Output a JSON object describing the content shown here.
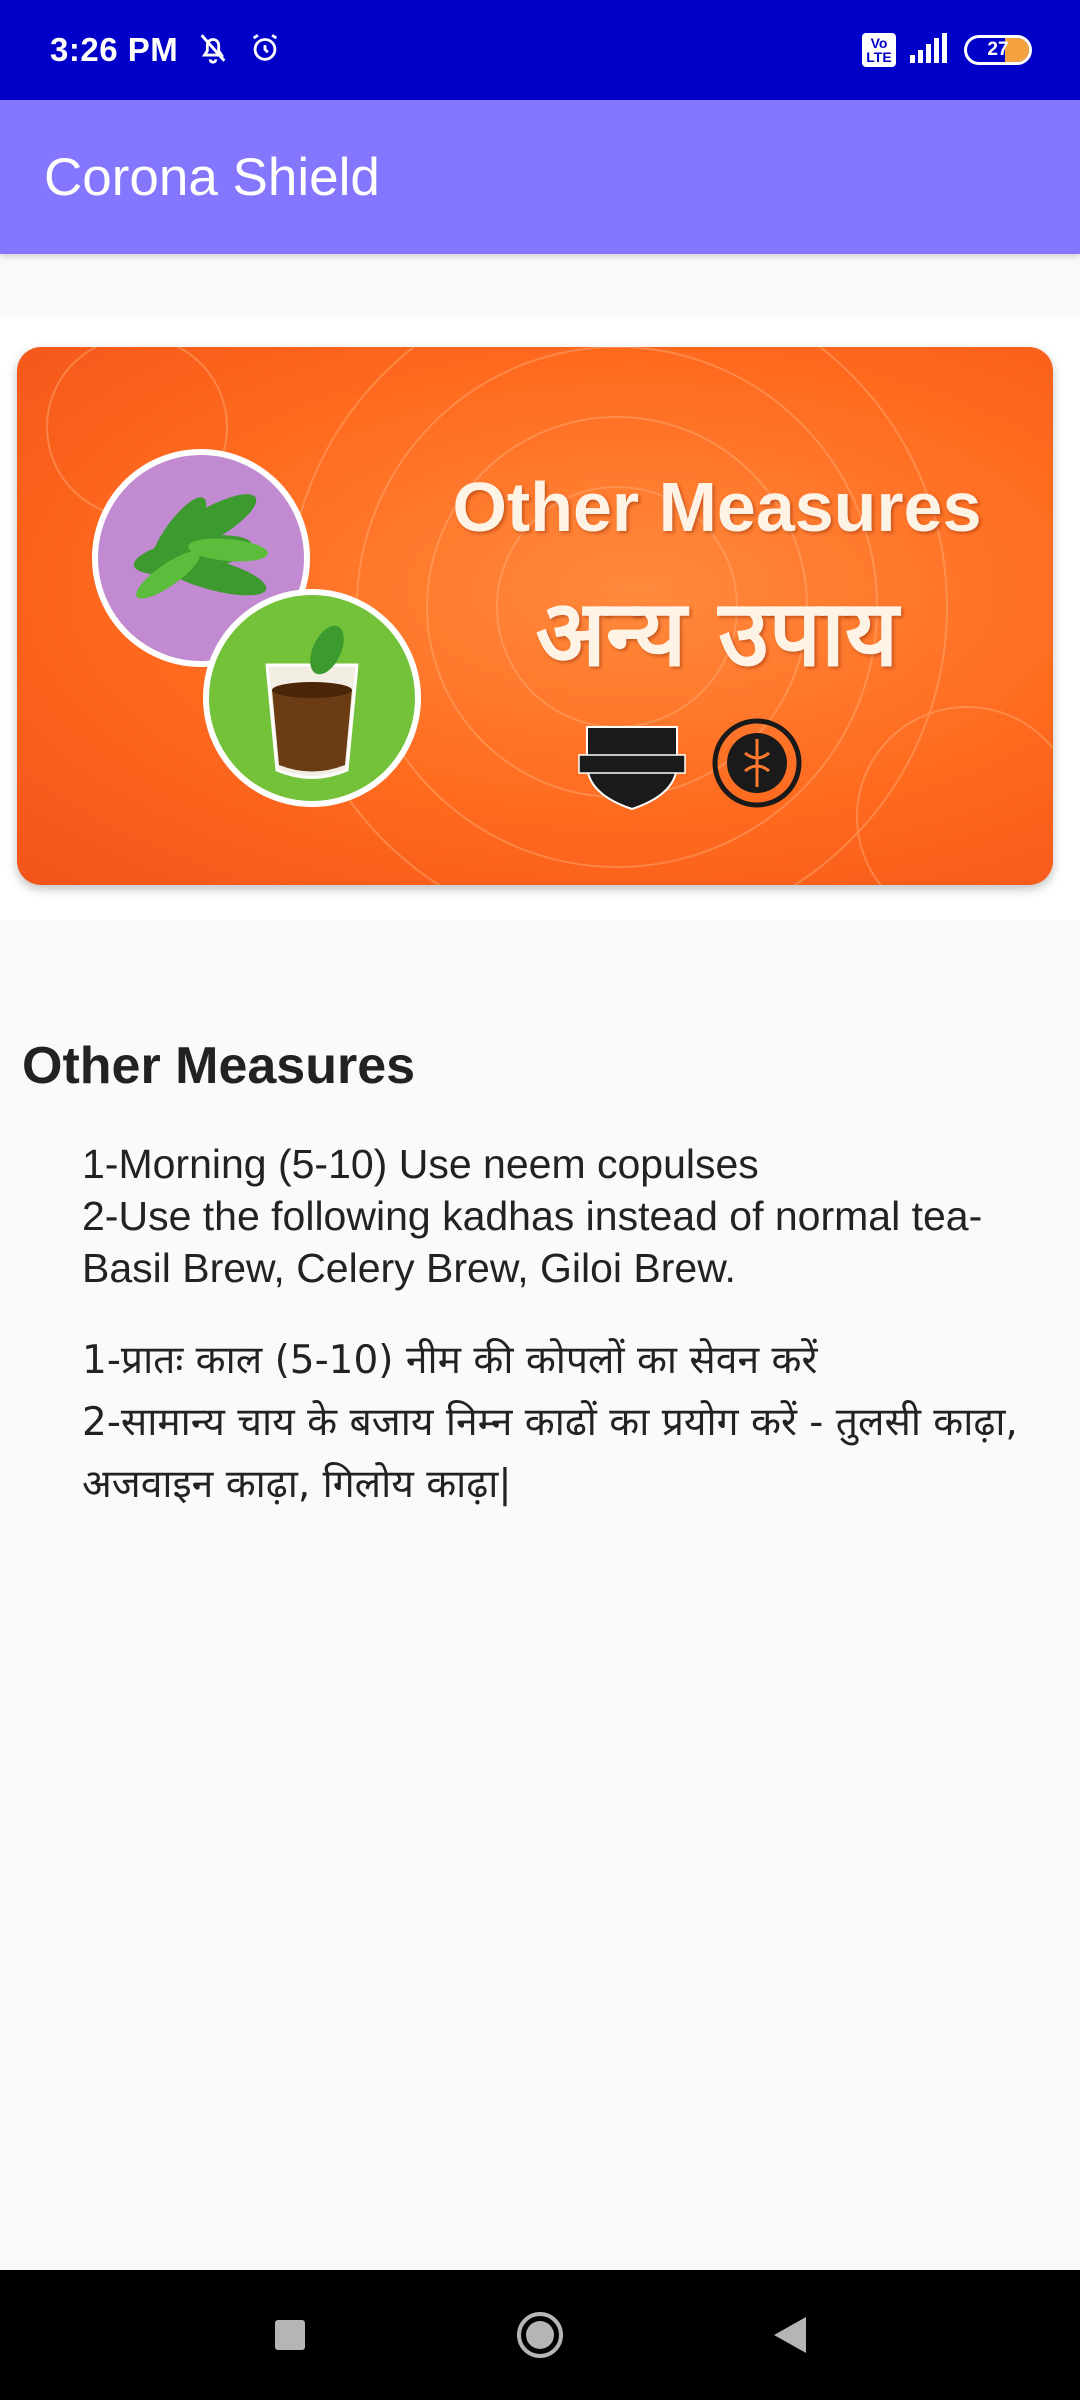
{
  "status_bar": {
    "time": "3:26 PM",
    "volte": "Vo LTE",
    "battery": "27",
    "icons": [
      "bell-off-icon",
      "alarm-icon",
      "volte-icon",
      "signal-icon",
      "battery-icon"
    ]
  },
  "app_bar": {
    "title": "Corona Shield"
  },
  "banner": {
    "title_en": "Other Measures",
    "title_hi": "अन्य उपाय",
    "logo_left": "AYUSH KAVACH",
    "logo_right": "AYUSH UTTAR PRADESH",
    "colors": {
      "background": "#ff6a1e",
      "neem_circle": "#c28ad1",
      "tea_circle": "#74c23a"
    }
  },
  "content": {
    "title": "Other Measures",
    "english": {
      "line1": "1-Morning (5-10) Use neem copulses",
      "line2": "2-Use the following kadhas instead of normal tea- Basil Brew, Celery Brew, Giloi Brew."
    },
    "hindi": {
      "line1": "1-प्रातः काल (5-10) नीम की कोपलों का सेवन करें",
      "line2": "2-सामान्य चाय के बजाय निम्न काढों का प्रयोग करें - तुलसी काढ़ा, अजवाइन काढ़ा, गिलोय काढ़ा|"
    }
  },
  "nav_bar": {
    "buttons": [
      "recents-square-icon",
      "home-circle-icon",
      "back-triangle-icon"
    ]
  },
  "colors": {
    "status_bar": "#0000c8",
    "app_bar": "#8476ff",
    "page_bg": "#fafafa"
  }
}
